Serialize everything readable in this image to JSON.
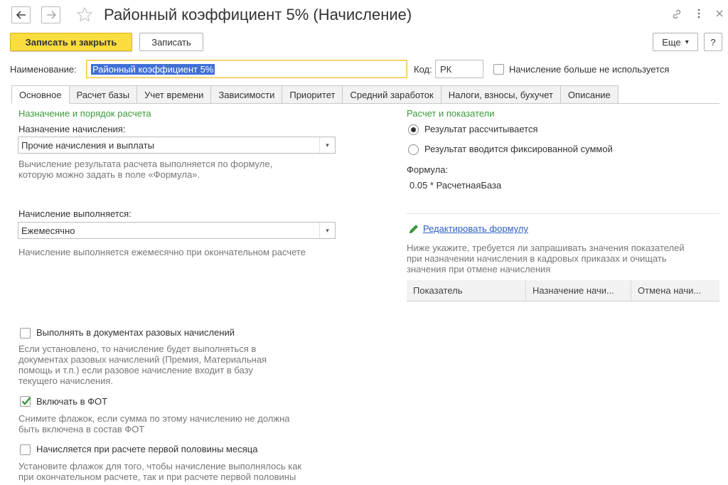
{
  "window": {
    "title": "Районный коэффициент 5% (Начисление)",
    "icons": [
      "back-arrow-icon",
      "forward-arrow-icon",
      "star-icon",
      "link-icon",
      "more-vertical-icon",
      "close-icon"
    ]
  },
  "toolbar": {
    "save_close_label": "Записать и закрыть",
    "save_label": "Записать",
    "more_label": "Еще",
    "more_arrow": "▾",
    "help_label": "?"
  },
  "header": {
    "name_label": "Наименование:",
    "name_value": "Районный коэффициент 5%",
    "code_label": "Код:",
    "code_value": "РК",
    "unused_label": "Начисление больше не используется",
    "unused_checked": false
  },
  "tabs": [
    {
      "label": "Основное",
      "active": true
    },
    {
      "label": "Расчет базы",
      "active": false
    },
    {
      "label": "Учет времени",
      "active": false
    },
    {
      "label": "Зависимости",
      "active": false
    },
    {
      "label": "Приоритет",
      "active": false
    },
    {
      "label": "Средний заработок",
      "active": false
    },
    {
      "label": "Налоги, взносы, бухучет",
      "active": false
    },
    {
      "label": "Описание",
      "active": false
    }
  ],
  "left": {
    "section_title": "Назначение и порядок расчета",
    "purpose_label": "Назначение начисления:",
    "purpose_value": "Прочие начисления и выплаты",
    "purpose_hint_1": "Вычисление результата расчета выполняется по формуле,",
    "purpose_hint_2": "которую можно задать в поле «Формула».",
    "period_label": "Начисление выполняется:",
    "period_value": "Ежемесячно",
    "period_hint": "Начисление выполняется ежемесячно при окончательном расчете",
    "onetime_label": "Выполнять в документах разовых начислений",
    "onetime_checked": false,
    "onetime_hint_1": "Если установлено, то начисление будет выполняться в",
    "onetime_hint_2": "документах разовых начислений (Премия, Материальная",
    "onetime_hint_3": "помощь и т.п.) если разовое начисление входит в базу",
    "onetime_hint_4": "текущего начисления.",
    "fot_label": "Включать в ФОТ",
    "fot_checked": true,
    "fot_hint_1": "Снимите флажок, если сумма по этому начислению не должна",
    "fot_hint_2": "быть включена в состав ФОТ",
    "half_label": "Начисляется при расчете первой половины месяца",
    "half_checked": false,
    "half_hint_1": "Установите флажок для того, чтобы начисление выполнялось как",
    "half_hint_2": "при окончательном расчете, так и при расчете первой половины"
  },
  "right": {
    "section_title": "Расчет и показатели",
    "radio_calc_label": "Результат рассчитывается",
    "radio_fixed_label": "Результат вводится фиксированной суммой",
    "selected_radio": "calc",
    "formula_label": "Формула:",
    "formula_value": "0.05 * РасчетнаяБаза",
    "edit_formula_label": "Редактировать формулу",
    "indicators_hint_1": "Ниже укажите, требуется ли запрашивать значения показателей",
    "indicators_hint_2": "при назначении начисления в кадровых приказах и очищать",
    "indicators_hint_3": "значения при отмене начисления",
    "grid_columns": [
      "Показатель",
      "Назначение начи...",
      "Отмена начи..."
    ]
  },
  "colors": {
    "primary_button": "#f9dc3d",
    "section_title": "#3a9a3a",
    "link": "#2c5fc4",
    "selection": "#3f6fd6"
  }
}
